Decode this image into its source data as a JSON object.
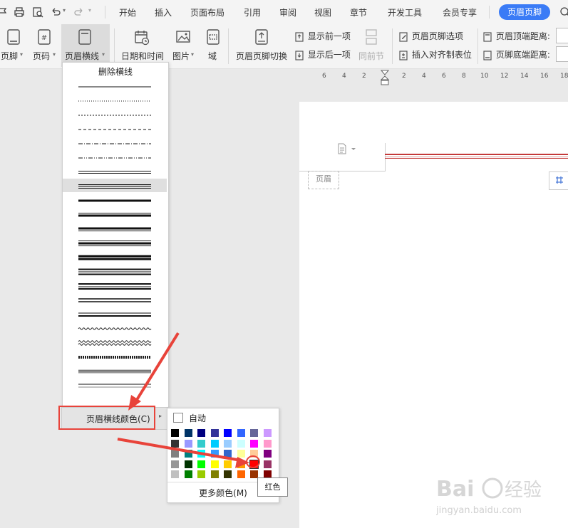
{
  "menu": {
    "tabs": [
      "开始",
      "插入",
      "页面布局",
      "引用",
      "审阅",
      "视图",
      "章节",
      "开发工具",
      "会员专享"
    ],
    "active_tab": "页眉页脚"
  },
  "ribbon": {
    "footer": "页脚",
    "page_num": "页码",
    "header_line": "页眉横线",
    "datetime": "日期和时间",
    "picture": "图片",
    "field": "域",
    "switch": "页眉页脚切换",
    "show_prev": "显示前一项",
    "show_next": "显示后一项",
    "same_as_prev": "同前节",
    "options": "页眉页脚选项",
    "insert_tab": "插入对齐制表位",
    "top_dist": "页眉顶端距离:",
    "bottom_dist": "页脚底端距离:"
  },
  "ruler": {
    "ticks": [
      "6",
      "4",
      "2",
      "2",
      "4",
      "6",
      "8",
      "10",
      "12",
      "14",
      "16",
      "18"
    ]
  },
  "document": {
    "header_label": "页眉"
  },
  "dropdown": {
    "delete_line": "删除横线",
    "line_styles": [
      "thin",
      "dotted",
      "dashed-fine",
      "dashed",
      "dash-dot",
      "dash-dot-dot",
      "double-thin",
      "triple-thin",
      "thick",
      "thin-thick",
      "thick-thin",
      "thin-thick-thin",
      "thick-thick",
      "triple",
      "thick-double",
      "double",
      "thin-medium",
      "wave",
      "double-wave",
      "hatched",
      "gradient",
      "gradient-thin"
    ],
    "highlighted_index": 7,
    "color_item": "页眉横线颜色(C)"
  },
  "palette": {
    "auto_label": "自动",
    "more_colors": "更多颜色(M)",
    "tooltip": "红色",
    "selected": "#ff0000",
    "rows": [
      [
        "#000000",
        "#003366",
        "#000080",
        "#333399",
        "#0000ff",
        "#3366ff",
        "#666699",
        "#cc99ff"
      ],
      [
        "#333333",
        "#9999ff",
        "#33cccc",
        "#00ccff",
        "#99ccff",
        "#ccffff",
        "#ff00ff",
        "#ff99cc"
      ],
      [
        "#808080",
        "#008080",
        "#00ffff",
        "#3399ff",
        "#3366cc",
        "#ffff99",
        "#ffcc99",
        "#800080"
      ],
      [
        "#969696",
        "#003300",
        "#00ff00",
        "#ffff00",
        "#ffcc00",
        "#ff9900",
        "#ff0000",
        "#993366"
      ],
      [
        "#c0c0c0",
        "#008000",
        "#99cc00",
        "#808000",
        "#333300",
        "#ff6600",
        "#993300",
        "#800000"
      ]
    ]
  },
  "watermark": {
    "logo": "Baidu经验",
    "url": "jingyan.baidu.com"
  }
}
